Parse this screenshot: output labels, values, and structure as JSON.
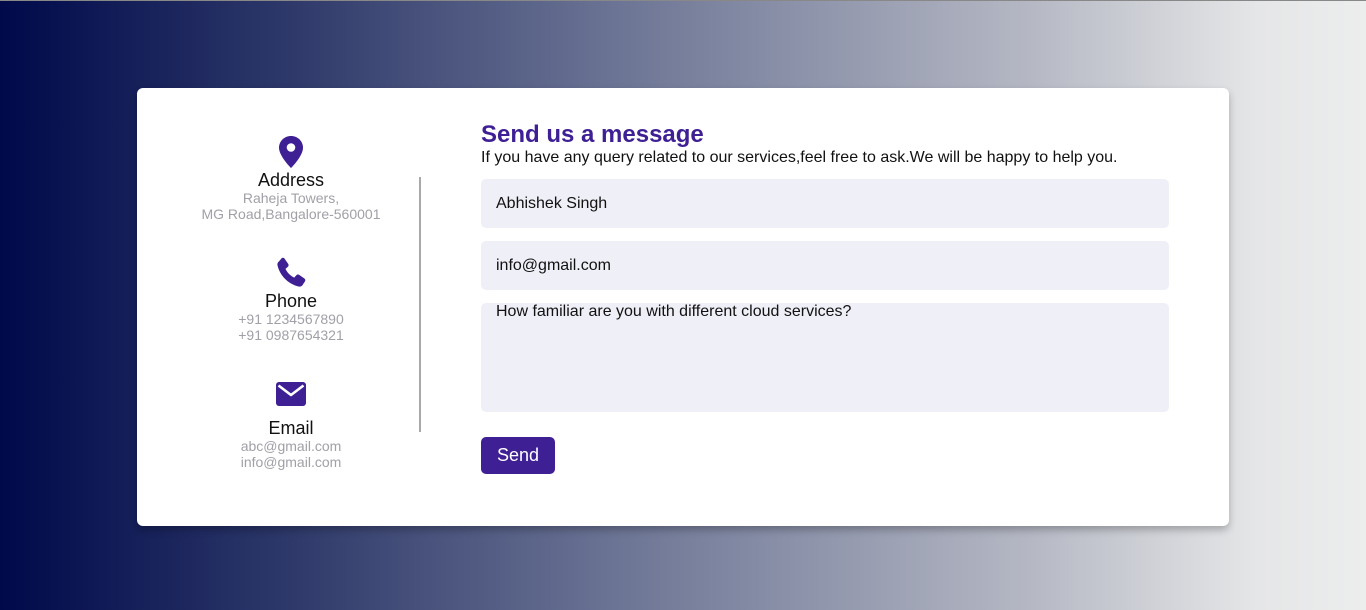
{
  "contact": {
    "address": {
      "icon": "map-pin-icon",
      "title": "Address",
      "line1": "Raheja Towers,",
      "line2": "MG Road,Bangalore-560001"
    },
    "phone": {
      "icon": "phone-icon",
      "title": "Phone",
      "line1": "+91 1234567890",
      "line2": "+91 0987654321"
    },
    "email": {
      "icon": "envelope-icon",
      "title": "Email",
      "line1": "abc@gmail.com",
      "line2": "info@gmail.com"
    }
  },
  "form": {
    "heading": "Send us a message",
    "subheading": "If you have any query related to our services,feel free to ask.We will be happy to help you.",
    "name_value": "Abhishek Singh",
    "email_value": "info@gmail.com",
    "message_value": "How familiar are you with different cloud services?",
    "send_label": "Send"
  },
  "colors": {
    "accent": "#3e1f94",
    "field_bg": "#efeff7",
    "muted_text": "#a0a0a8"
  }
}
